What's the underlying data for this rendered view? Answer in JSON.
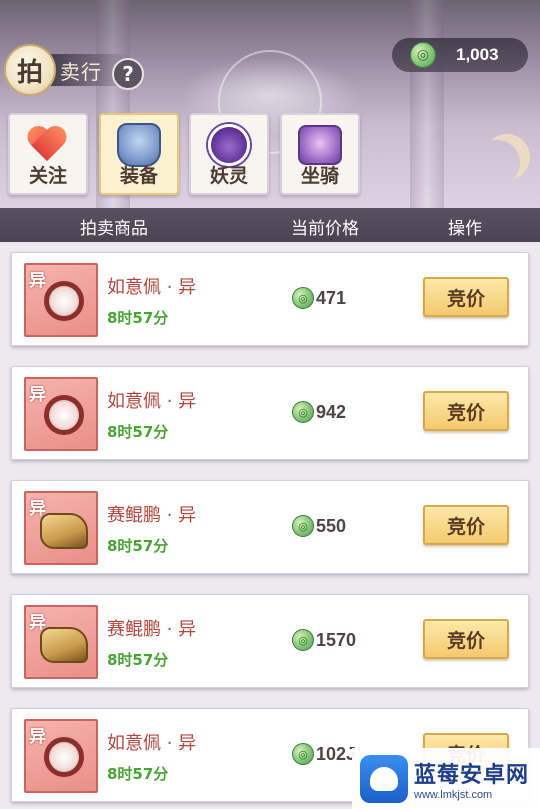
{
  "currency": {
    "amount": "1,003",
    "icon": "jade-coin-icon"
  },
  "title": {
    "badge": "拍",
    "rest": "卖行",
    "help": "?"
  },
  "tabs": [
    {
      "label": "关注",
      "icon": "heart-icon",
      "active": false
    },
    {
      "label": "装备",
      "icon": "armor-icon",
      "active": true
    },
    {
      "label": "妖灵",
      "icon": "spirit-icon",
      "active": false
    },
    {
      "label": "坐骑",
      "icon": "mount-icon",
      "active": false
    }
  ],
  "columns": {
    "item": "拍卖商品",
    "price": "当前价格",
    "action": "操作"
  },
  "items": [
    {
      "tag": "异",
      "name": "如意佩 · 异",
      "time": "8时57分",
      "price": "471",
      "button": "竞价",
      "art": "pendant"
    },
    {
      "tag": "异",
      "name": "如意佩 · 异",
      "time": "8时57分",
      "price": "942",
      "button": "竞价",
      "art": "pendant"
    },
    {
      "tag": "异",
      "name": "赛鲲鹏 · 异",
      "time": "8时57分",
      "price": "550",
      "button": "竞价",
      "art": "boot"
    },
    {
      "tag": "异",
      "name": "赛鲲鹏 · 异",
      "time": "8时57分",
      "price": "1570",
      "button": "竞价",
      "art": "boot"
    },
    {
      "tag": "异",
      "name": "如意佩 · 异",
      "time": "8时57分",
      "price": "102J",
      "button": "竞价",
      "art": "pendant"
    }
  ],
  "watermark": {
    "title": "蓝莓安卓网",
    "url": "www.lmkjst.com"
  },
  "colors": {
    "name": "#b2463c",
    "time": "#49a335",
    "header": "#4c4352",
    "button": "#f4c96e"
  }
}
